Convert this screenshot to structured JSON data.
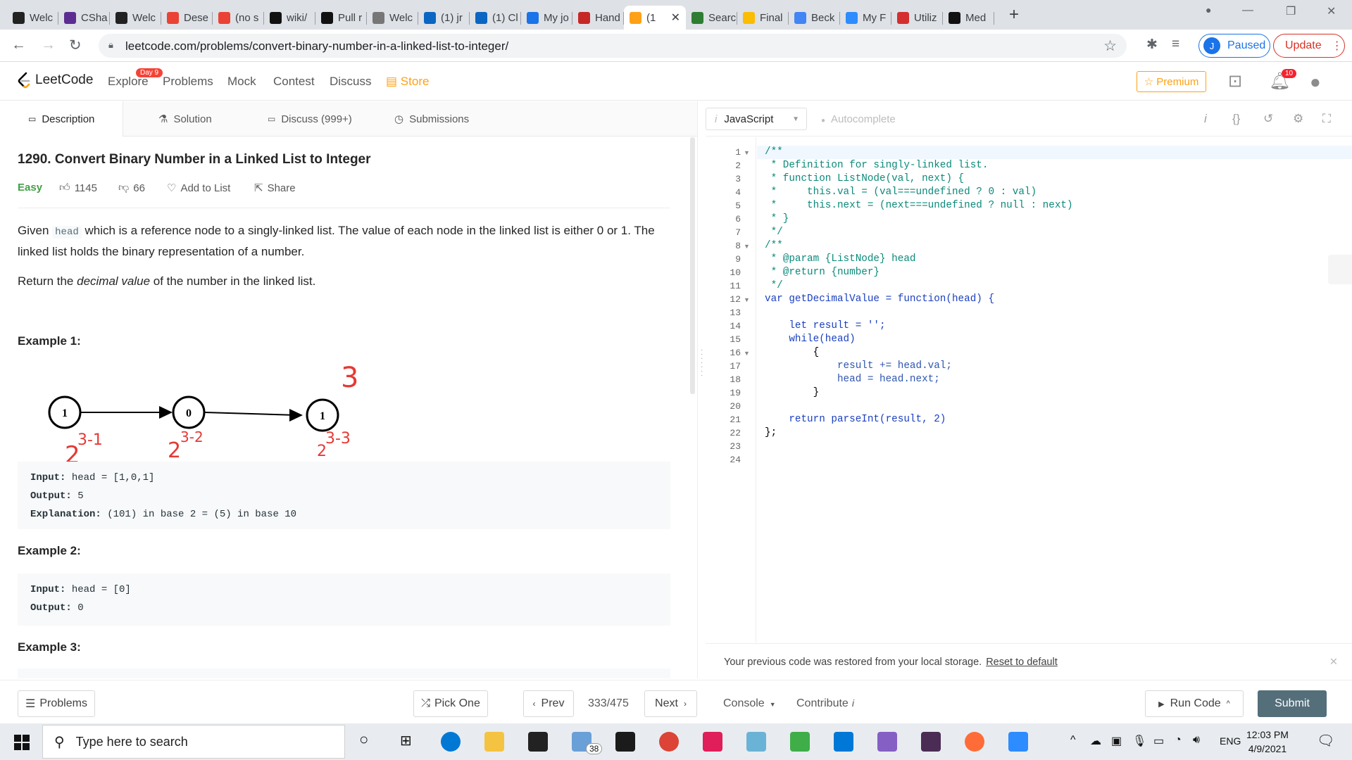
{
  "browser": {
    "tabs": [
      {
        "label": "Welc",
        "color": "#222"
      },
      {
        "label": "CSha",
        "color": "#5c2d91"
      },
      {
        "label": "Welc",
        "color": "#222"
      },
      {
        "label": "Dese",
        "color": "#ea4335"
      },
      {
        "label": "(no s",
        "color": "#ea4335"
      },
      {
        "label": "wiki/",
        "color": "#111"
      },
      {
        "label": "Pull r",
        "color": "#111"
      },
      {
        "label": "Welc",
        "color": "#777"
      },
      {
        "label": "(1) jr",
        "color": "#0a66c2"
      },
      {
        "label": "(1) Cl",
        "color": "#0a66c2"
      },
      {
        "label": "My jo",
        "color": "#1a73e8"
      },
      {
        "label": "Hand",
        "color": "#c62828"
      },
      {
        "label": "(1",
        "color": "#ffa116"
      },
      {
        "label": "Searc",
        "color": "#2e7d32"
      },
      {
        "label": "Final",
        "color": "#fbbc04"
      },
      {
        "label": "Beck",
        "color": "#4285f4"
      },
      {
        "label": "My F",
        "color": "#2d8cff"
      },
      {
        "label": "Utiliz",
        "color": "#d32f2f"
      },
      {
        "label": "Med",
        "color": "#111"
      }
    ],
    "url": "leetcode.com/problems/convert-binary-number-in-a-linked-list-to-integer/",
    "profile_initial": "J",
    "paused_label": "Paused",
    "update_label": "Update"
  },
  "header": {
    "logo_text": "LeetCode",
    "day_badge": "Day 9",
    "nav": [
      "Explore",
      "Problems",
      "Mock",
      "Contest",
      "Discuss",
      "Store"
    ],
    "premium_label": "☆ Premium",
    "notif_count": "10"
  },
  "left_tabs": {
    "description": "Description",
    "solution": "Solution",
    "discuss": "Discuss (999+)",
    "submissions": "Submissions"
  },
  "problem": {
    "title": "1290. Convert Binary Number in a Linked List to Integer",
    "difficulty": "Easy",
    "likes": "1145",
    "dislikes": "66",
    "add_to_list": "Add to List",
    "share": "Share",
    "desc_pre": "Given ",
    "desc_code": "head",
    "desc_post": " which is a reference node to a singly-linked list. The value of each node in the linked list is either 0 or 1. The linked list holds the binary representation of a number.",
    "return_pre": "Return the ",
    "return_em": "decimal value",
    "return_post": " of the number in the linked list.",
    "ex1_heading": "Example 1:",
    "ex1_input_label": "Input:",
    "ex1_input": " head = [1,0,1]",
    "ex1_output_label": "Output:",
    "ex1_output": " 5",
    "ex1_expl_label": "Explanation:",
    "ex1_expl": " (101) in base 2 = (5) in base 10",
    "ex2_heading": "Example 2:",
    "ex2_input_label": "Input:",
    "ex2_input": " head = [0]",
    "ex2_output_label": "Output:",
    "ex2_output": " 0",
    "ex3_heading": "Example 3:",
    "nodes": [
      "1",
      "0",
      "1"
    ],
    "annotations": [
      "3",
      "2",
      "3-1",
      "2",
      "3-2",
      "2",
      "3-3"
    ]
  },
  "editor": {
    "language": "JavaScript",
    "autocomplete": "Autocomplete",
    "lines": [
      "1",
      "2",
      "3",
      "4",
      "5",
      "6",
      "7",
      "8",
      "9",
      "10",
      "11",
      "12",
      "13",
      "14",
      "15",
      "16",
      "17",
      "18",
      "19",
      "20",
      "21",
      "22",
      "23",
      "24"
    ],
    "code": {
      "l1": "/**",
      "l2": " * Definition for singly-linked list.",
      "l3": " * function ListNode(val, next) {",
      "l4": " *     this.val = (val===undefined ? 0 : val)",
      "l5": " *     this.next = (next===undefined ? null : next)",
      "l6": " * }",
      "l7": " */",
      "l8": "/**",
      "l9": " * @param {ListNode} head",
      "l10": " * @return {number}",
      "l11": " */",
      "l12": "var getDecimalValue = function(head) {",
      "l14": "    let result = '';",
      "l15": "    while(head)",
      "l16": "        {",
      "l17": "            result += head.val;",
      "l18": "            head = head.next;",
      "l19": "        }",
      "l21": "    return parseInt(result, 2)",
      "l22": "};"
    },
    "restore_msg": "Your previous code was restored from your local storage.",
    "reset_label": "Reset to default"
  },
  "bottom": {
    "problems": "Problems",
    "pick_one": "Pick One",
    "prev": "Prev",
    "page": "333/475",
    "next": "Next",
    "console": "Console",
    "contribute": "Contribute",
    "run_code": "Run Code",
    "submit": "Submit"
  },
  "taskbar": {
    "search_placeholder": "Type here to search",
    "mail_badge": "38",
    "lang": "ENG",
    "time": "12:03 PM",
    "date": "4/9/2021"
  }
}
